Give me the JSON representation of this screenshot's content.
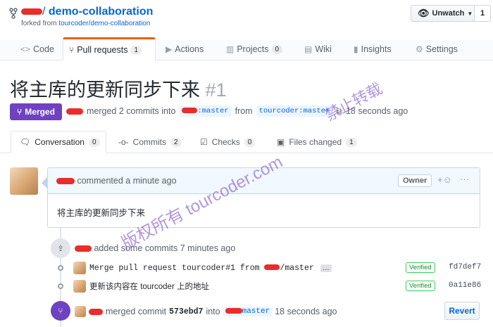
{
  "repo": {
    "owner_redacted": "",
    "separator": "/",
    "name": "demo-collaboration",
    "forked_prefix": "forked from",
    "forked_link": "tourcoder/demo-collaboration"
  },
  "watch": {
    "label": "Unwatch",
    "count": "1"
  },
  "tabs": [
    {
      "label": "Code",
      "icon": "code-icon",
      "counter": ""
    },
    {
      "label": "Pull requests",
      "icon": "pull-request-icon",
      "counter": "1"
    },
    {
      "label": "Actions",
      "icon": "play-icon",
      "counter": ""
    },
    {
      "label": "Projects",
      "icon": "project-icon",
      "counter": "0"
    },
    {
      "label": "Wiki",
      "icon": "book-icon",
      "counter": ""
    },
    {
      "label": "Insights",
      "icon": "graph-icon",
      "counter": ""
    },
    {
      "label": "Settings",
      "icon": "gear-icon",
      "counter": ""
    }
  ],
  "pr": {
    "title": "将主库的更新同步下来",
    "number": "#1",
    "state": "Merged",
    "merged_text": "merged 2 commits into",
    "base_branch": "master",
    "from_text": "from",
    "head_branch": "tourcoder:master",
    "time": "18 seconds ago"
  },
  "pr_tabs": [
    {
      "label": "Conversation",
      "count": "0",
      "icon": "comment-icon"
    },
    {
      "label": "Commits",
      "count": "2",
      "icon": "commit-icon"
    },
    {
      "label": "Checks",
      "count": "0",
      "icon": "checklist-icon"
    },
    {
      "label": "Files changed",
      "count": "1",
      "icon": "file-diff-icon"
    }
  ],
  "comment": {
    "action": "commented a minute ago",
    "role": "Owner",
    "reactions_icon": "+☺",
    "more": "···",
    "body": "将主库的更新同步下来"
  },
  "event_commits": {
    "text": "added some commits 7 minutes ago"
  },
  "commits": [
    {
      "message_prefix": "Merge pull request tourcoder#1 from ",
      "message_suffix": "/master",
      "ellipsis": "…",
      "verified": "Verified",
      "sha": "fd7def7"
    },
    {
      "message_prefix": "更新该内容在 tourcoder 上的地址",
      "message_suffix": "",
      "ellipsis": "",
      "verified": "Verified",
      "sha": "0a11e86"
    }
  ],
  "merge_event": {
    "text": "merged commit",
    "sha": "573ebd7",
    "into": "into",
    "branch": "master",
    "time": "18 seconds ago",
    "revert_label": "Revert"
  },
  "watermark": {
    "line1": "禁止转载",
    "line2": "版权所有 tourcoder.com"
  },
  "colors": {
    "merged": "#6f42c1",
    "link": "#0366d6",
    "redaction": "#e8221f",
    "tab_accent": "#e36209"
  }
}
